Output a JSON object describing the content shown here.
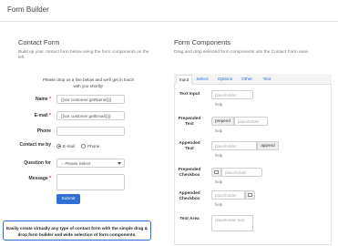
{
  "app": {
    "title": "Form Builder"
  },
  "left": {
    "title": "Contact Form",
    "desc": "Build up your contact form below using the form components on the left.",
    "intro": "Please drop us a line below and we'll get in touch with you shortly!",
    "fields": {
      "name_label": "Name",
      "name_value": "{{var customer.getName()}}",
      "email_label": "E-mail",
      "email_value": "{{var customer.getEmail()}}",
      "phone_label": "Phone",
      "contact_label": "Contact me by",
      "contact_opt1": "E-mail",
      "contact_opt2": "Phone",
      "question_label": "Question for",
      "question_value": "-- Please Select",
      "message_label": "Message",
      "required_mark": "*"
    },
    "submit_label": "Submit"
  },
  "callout": "Easily create virtually any type of contact form with the simple drag & drop form builder and wide selection of form components.",
  "right": {
    "title": "Form Components",
    "desc": "Drag and drop selected form components into the Contact Form area.",
    "tabs": [
      "Input",
      "Select",
      "Options",
      "Other",
      "Text"
    ],
    "components": {
      "text_input_label": "Text Input",
      "prepended_text_label": "Prepended Text",
      "appended_text_label": "Appended Text",
      "prepended_checkbox_label": "Prepended Checkbox",
      "appended_checkbox_label": "Appended Checkbox",
      "text_area_label": "Text Area",
      "placeholder": "placeholder",
      "prepend_addon": "prepend",
      "append_addon": "append",
      "help": "help",
      "textarea_placeholder": "placeholder text"
    }
  }
}
